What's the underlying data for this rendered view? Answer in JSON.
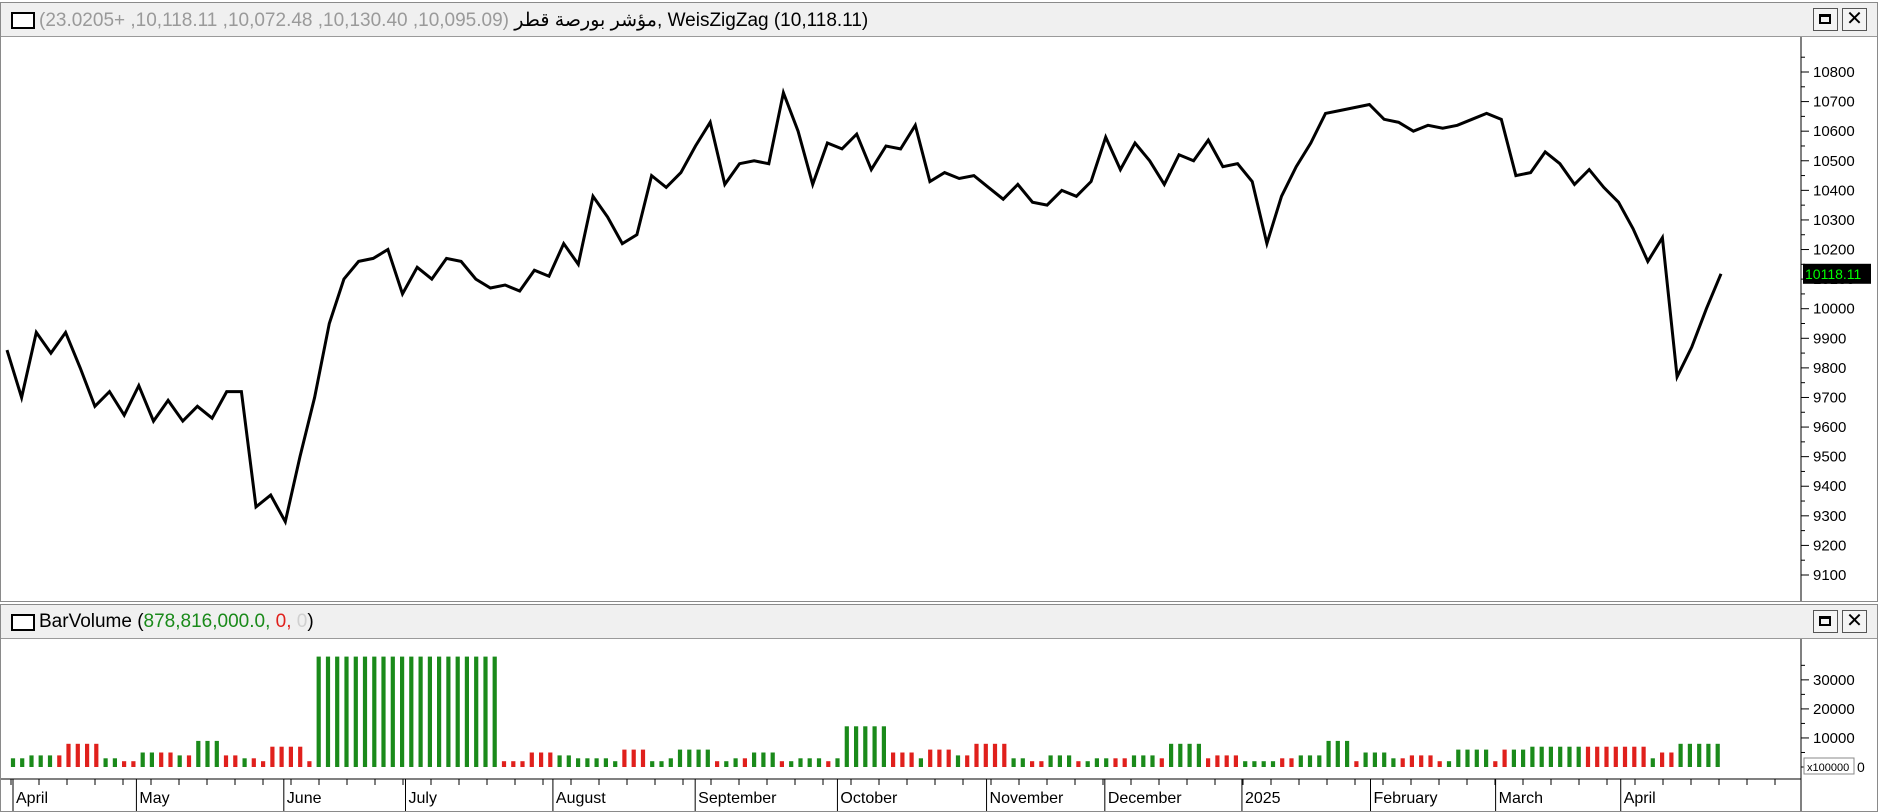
{
  "price_panel": {
    "index_name": "مؤشر بورصة قطر",
    "ohlc_text": "(10,095.09, 10,130.40, 10,072.48, 10,118.11, +23.0205)",
    "separator": ",",
    "indicator_text": "WeisZigZag (10,118.11)",
    "last_value_label": "10118.11",
    "minimize_label": "",
    "close_label": "✕"
  },
  "volume_panel": {
    "title_prefix": "BarVolume (",
    "volume_value": "878,816,000.0",
    "comma1": ", ",
    "second_value": "0",
    "comma2": ", ",
    "third_value": "0",
    "title_suffix": ")",
    "multiplier_label": "x100000",
    "zero_label": "0",
    "close_label": "✕"
  },
  "colors": {
    "line": "#000000",
    "volume_up": "#1a8a1a",
    "volume_down": "#e0201c",
    "last_value_bg": "#000000",
    "last_value_fg": "#00ff00"
  },
  "chart_data": [
    {
      "type": "line",
      "series": [
        {
          "name": "WeisZigZag",
          "values": [
            9860,
            9700,
            9920,
            9850,
            9920,
            9800,
            9670,
            9720,
            9640,
            9740,
            9620,
            9690,
            9620,
            9670,
            9630,
            9720,
            9720,
            9330,
            9370,
            9280,
            9500,
            9700,
            9950,
            10100,
            10160,
            10170,
            10200,
            10050,
            10140,
            10100,
            10170,
            10160,
            10100,
            10070,
            10080,
            10060,
            10130,
            10110,
            10220,
            10150,
            10380,
            10310,
            10220,
            10250,
            10450,
            10410,
            10460,
            10550,
            10630,
            10420,
            10490,
            10500,
            10490,
            10730,
            10600,
            10420,
            10560,
            10540,
            10590,
            10470,
            10550,
            10540,
            10620,
            10430,
            10460,
            10440,
            10450,
            10410,
            10370,
            10420,
            10360,
            10350,
            10400,
            10380,
            10430,
            10580,
            10470,
            10560,
            10500,
            10420,
            10520,
            10500,
            10570,
            10480,
            10490,
            10430,
            10220,
            10380,
            10480,
            10560,
            10660,
            10670,
            10680,
            10690,
            10640,
            10630,
            10600,
            10620,
            10610,
            10620,
            10640,
            10660,
            10640,
            10450,
            10460,
            10530,
            10490,
            10420,
            10470,
            10410,
            10360,
            10270,
            10160,
            10240,
            9770,
            9870,
            10000,
            10118
          ]
        }
      ],
      "ylim": [
        9050,
        10880
      ],
      "yticks": [
        9100,
        9200,
        9300,
        9400,
        9500,
        9600,
        9700,
        9800,
        9900,
        10000,
        10100,
        10200,
        10300,
        10400,
        10500,
        10600,
        10700,
        10800
      ]
    },
    {
      "type": "bar",
      "series": [
        {
          "name": "BarVolume",
          "values": [
            3000,
            3000,
            4000,
            4000,
            4000,
            4000,
            8000,
            8000,
            8000,
            8000,
            3000,
            3000,
            2000,
            2000,
            5000,
            5000,
            5000,
            5000,
            4000,
            4000,
            9000,
            9000,
            9000,
            4000,
            4000,
            3000,
            3000,
            2000,
            7000,
            7000,
            7000,
            7000,
            2000,
            38000,
            38000,
            38000,
            38000,
            38000,
            38000,
            38000,
            38000,
            38000,
            38000,
            38000,
            38000,
            38000,
            38000,
            38000,
            38000,
            38000,
            38000,
            38000,
            38000,
            2000,
            2000,
            2000,
            5000,
            5000,
            5000,
            4000,
            4000,
            3000,
            3000,
            3000,
            3000,
            2000,
            6000,
            6000,
            6000,
            2000,
            2000,
            3000,
            6000,
            6000,
            6000,
            6000,
            2000,
            2000,
            3000,
            3000,
            5000,
            5000,
            5000,
            2000,
            2000,
            3000,
            3000,
            3000,
            2000,
            3000,
            14000,
            14000,
            14000,
            14000,
            14000,
            5000,
            5000,
            5000,
            3000,
            6000,
            6000,
            6000,
            4000,
            4000,
            8000,
            8000,
            8000,
            8000,
            3000,
            3000,
            2000,
            2000,
            4000,
            4000,
            4000,
            2000,
            2000,
            3000,
            3000,
            3000,
            3000,
            4000,
            4000,
            4000,
            3000,
            8000,
            8000,
            8000,
            8000,
            3000,
            4000,
            4000,
            4000,
            2000,
            2000,
            2000,
            2000,
            3000,
            3000,
            4000,
            4000,
            4000,
            9000,
            9000,
            9000,
            2000,
            5000,
            5000,
            5000,
            3000,
            3000,
            4000,
            4000,
            4000,
            2000,
            2000,
            6000,
            6000,
            6000,
            6000,
            2000,
            6000,
            6000,
            6000,
            7000,
            7000,
            7000,
            7000,
            7000,
            7000,
            7000,
            7000,
            7000,
            7000,
            7000,
            7000,
            7000,
            3000,
            5000,
            5000,
            8000,
            8000,
            8000,
            8000,
            8000
          ]
        }
      ],
      "colors": [
        "g",
        "g",
        "g",
        "g",
        "g",
        "r",
        "r",
        "r",
        "r",
        "r",
        "g",
        "g",
        "r",
        "r",
        "g",
        "g",
        "r",
        "r",
        "g",
        "r",
        "g",
        "g",
        "g",
        "r",
        "r",
        "g",
        "r",
        "r",
        "r",
        "r",
        "r",
        "r",
        "r",
        "g",
        "g",
        "g",
        "g",
        "g",
        "g",
        "g",
        "g",
        "g",
        "g",
        "g",
        "g",
        "g",
        "g",
        "g",
        "g",
        "g",
        "g",
        "g",
        "g",
        "r",
        "r",
        "r",
        "r",
        "r",
        "r",
        "g",
        "g",
        "g",
        "g",
        "g",
        "g",
        "g",
        "r",
        "r",
        "r",
        "g",
        "g",
        "g",
        "g",
        "g",
        "g",
        "g",
        "r",
        "g",
        "g",
        "r",
        "g",
        "g",
        "g",
        "r",
        "g",
        "g",
        "g",
        "g",
        "r",
        "g",
        "g",
        "g",
        "g",
        "g",
        "g",
        "r",
        "r",
        "r",
        "g",
        "r",
        "r",
        "r",
        "g",
        "r",
        "r",
        "r",
        "r",
        "r",
        "g",
        "g",
        "r",
        "r",
        "g",
        "g",
        "g",
        "r",
        "g",
        "g",
        "g",
        "r",
        "r",
        "g",
        "g",
        "g",
        "r",
        "g",
        "g",
        "g",
        "g",
        "r",
        "r",
        "r",
        "r",
        "g",
        "g",
        "g",
        "g",
        "r",
        "r",
        "g",
        "g",
        "g",
        "g",
        "g",
        "g",
        "r",
        "g",
        "g",
        "g",
        "g",
        "r",
        "r",
        "r",
        "r",
        "r",
        "g",
        "g",
        "g",
        "g",
        "g",
        "r",
        "r",
        "g",
        "g",
        "g",
        "g",
        "g",
        "g",
        "g",
        "g",
        "r",
        "r",
        "r",
        "r",
        "r",
        "r",
        "r",
        "g",
        "r",
        "r",
        "g",
        "g",
        "g",
        "g",
        "g"
      ],
      "ylim": [
        0,
        42000
      ],
      "yticks": [
        0,
        10000,
        20000,
        30000
      ]
    }
  ],
  "x_axis": {
    "months": [
      {
        "label": "April",
        "pos": 0.0
      },
      {
        "label": "May",
        "pos": 0.072
      },
      {
        "label": "June",
        "pos": 0.158
      },
      {
        "label": "July",
        "pos": 0.229
      },
      {
        "label": "August",
        "pos": 0.315
      },
      {
        "label": "September",
        "pos": 0.398
      },
      {
        "label": "October",
        "pos": 0.481
      },
      {
        "label": "November",
        "pos": 0.568
      },
      {
        "label": "December",
        "pos": 0.637
      },
      {
        "label": "2025",
        "pos": 0.717
      },
      {
        "label": "February",
        "pos": 0.792
      },
      {
        "label": "March",
        "pos": 0.865
      },
      {
        "label": "April",
        "pos": 0.938
      }
    ]
  }
}
